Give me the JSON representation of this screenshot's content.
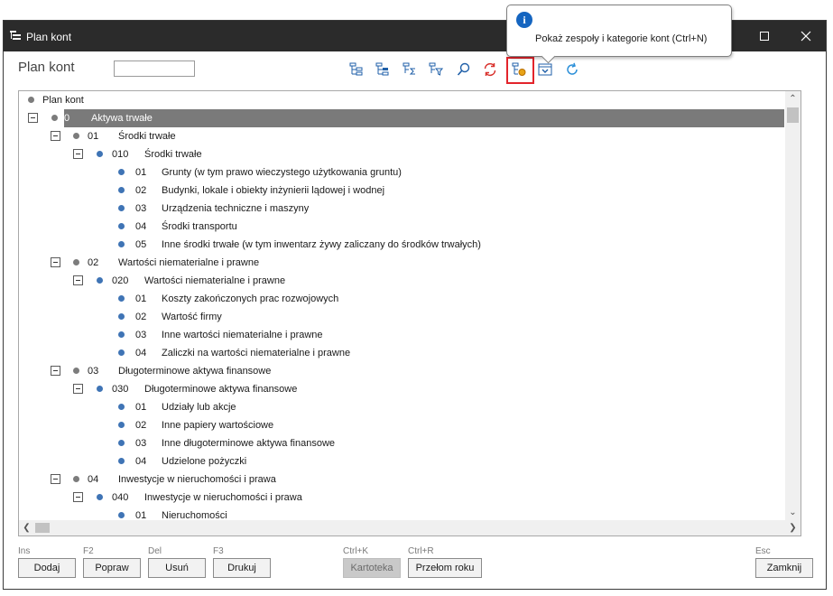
{
  "window": {
    "title": "Plan kont",
    "controls": [
      "minimize",
      "maximize",
      "close"
    ]
  },
  "header": {
    "label": "Plan kont",
    "search_value": ""
  },
  "tooltip": {
    "text": "Pokaż zespoły i kategorie kont (Ctrl+N)"
  },
  "colors": {
    "titlebar": "#2b2b2b",
    "selected_row": "#7a7a7a",
    "dot_blue": "#3f74b5",
    "dot_gray": "#7c7c7c",
    "highlight": "#e3242b",
    "icon_blue": "#1f5fa8",
    "icon_red": "#d9312c"
  },
  "tree": {
    "root": {
      "label": "Plan kont"
    },
    "rows": [
      {
        "level": 0,
        "code": "0",
        "label": "Aktywa trwałe",
        "toggle": true,
        "dot": "gray",
        "selected": true
      },
      {
        "level": 1,
        "code": "01",
        "label": "Środki trwałe",
        "toggle": true,
        "dot": "gray"
      },
      {
        "level": 2,
        "code": "010",
        "label": "Środki trwałe",
        "toggle": true,
        "dot": "blue"
      },
      {
        "level": 3,
        "code": "01",
        "label": "Grunty (w tym prawo wieczystego użytkowania gruntu)",
        "toggle": false,
        "dot": "blue"
      },
      {
        "level": 3,
        "code": "02",
        "label": "Budynki, lokale i obiekty inżynierii lądowej i wodnej",
        "toggle": false,
        "dot": "blue"
      },
      {
        "level": 3,
        "code": "03",
        "label": "Urządzenia techniczne i maszyny",
        "toggle": false,
        "dot": "blue"
      },
      {
        "level": 3,
        "code": "04",
        "label": "Środki transportu",
        "toggle": false,
        "dot": "blue"
      },
      {
        "level": 3,
        "code": "05",
        "label": "Inne środki trwałe (w tym inwentarz żywy zaliczany do środków trwałych)",
        "toggle": false,
        "dot": "blue"
      },
      {
        "level": 1,
        "code": "02",
        "label": "Wartości niematerialne i prawne",
        "toggle": true,
        "dot": "gray"
      },
      {
        "level": 2,
        "code": "020",
        "label": "Wartości niematerialne i prawne",
        "toggle": true,
        "dot": "blue"
      },
      {
        "level": 3,
        "code": "01",
        "label": "Koszty zakończonych prac rozwojowych",
        "toggle": false,
        "dot": "blue"
      },
      {
        "level": 3,
        "code": "02",
        "label": "Wartość firmy",
        "toggle": false,
        "dot": "blue"
      },
      {
        "level": 3,
        "code": "03",
        "label": "Inne wartości niematerialne i prawne",
        "toggle": false,
        "dot": "blue"
      },
      {
        "level": 3,
        "code": "04",
        "label": "Zaliczki na wartości niematerialne i prawne",
        "toggle": false,
        "dot": "blue"
      },
      {
        "level": 1,
        "code": "03",
        "label": "Długoterminowe aktywa finansowe",
        "toggle": true,
        "dot": "gray"
      },
      {
        "level": 2,
        "code": "030",
        "label": "Długoterminowe aktywa finansowe",
        "toggle": true,
        "dot": "blue"
      },
      {
        "level": 3,
        "code": "01",
        "label": "Udziały lub akcje",
        "toggle": false,
        "dot": "blue"
      },
      {
        "level": 3,
        "code": "02",
        "label": "Inne papiery wartościowe",
        "toggle": false,
        "dot": "blue"
      },
      {
        "level": 3,
        "code": "03",
        "label": "Inne długoterminowe aktywa finansowe",
        "toggle": false,
        "dot": "blue"
      },
      {
        "level": 3,
        "code": "04",
        "label": "Udzielone pożyczki",
        "toggle": false,
        "dot": "blue"
      },
      {
        "level": 1,
        "code": "04",
        "label": "Inwestycje w nieruchomości i prawa",
        "toggle": true,
        "dot": "gray"
      },
      {
        "level": 2,
        "code": "040",
        "label": "Inwestycje w nieruchomości i prawa",
        "toggle": true,
        "dot": "blue"
      },
      {
        "level": 3,
        "code": "01",
        "label": "Nieruchomości",
        "toggle": false,
        "dot": "blue"
      }
    ]
  },
  "footer": {
    "buttons": [
      {
        "shortcut": "Ins",
        "label": "Dodaj",
        "disabled": false
      },
      {
        "shortcut": "F2",
        "label": "Popraw",
        "disabled": false
      },
      {
        "shortcut": "Del",
        "label": "Usuń",
        "disabled": false
      },
      {
        "shortcut": "F3",
        "label": "Drukuj",
        "disabled": false
      },
      {
        "shortcut": "Ctrl+K",
        "label": "Kartoteka",
        "disabled": true
      },
      {
        "shortcut": "Ctrl+R",
        "label": "Przełom roku",
        "disabled": false
      },
      {
        "shortcut": "Esc",
        "label": "Zamknij",
        "disabled": false
      }
    ]
  }
}
